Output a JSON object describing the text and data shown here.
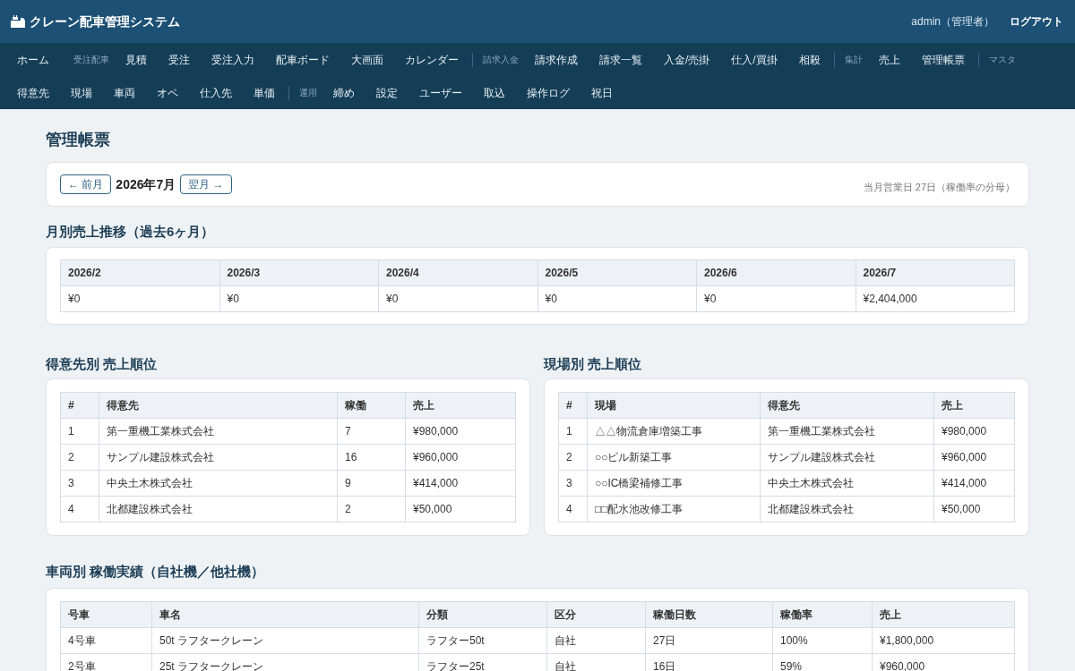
{
  "header": {
    "title": "クレーン配車管理システム",
    "user": "admin（管理者）",
    "logout": "ログアウト"
  },
  "nav": {
    "items": [
      {
        "kind": "link",
        "label": "ホーム"
      },
      {
        "kind": "group",
        "label": "受注配車",
        "divider": false
      },
      {
        "kind": "link",
        "label": "見積"
      },
      {
        "kind": "link",
        "label": "受注"
      },
      {
        "kind": "link",
        "label": "受注入力"
      },
      {
        "kind": "link",
        "label": "配車ボード"
      },
      {
        "kind": "link",
        "label": "大画面"
      },
      {
        "kind": "link",
        "label": "カレンダー"
      },
      {
        "kind": "group",
        "label": "請求入金",
        "divider": true
      },
      {
        "kind": "link",
        "label": "請求作成"
      },
      {
        "kind": "link",
        "label": "請求一覧"
      },
      {
        "kind": "link",
        "label": "入金/売掛"
      },
      {
        "kind": "link",
        "label": "仕入/買掛"
      },
      {
        "kind": "link",
        "label": "相殺"
      },
      {
        "kind": "group",
        "label": "集計",
        "divider": true
      },
      {
        "kind": "link",
        "label": "売上"
      },
      {
        "kind": "link",
        "label": "管理帳票"
      },
      {
        "kind": "group",
        "label": "マスタ",
        "divider": true
      },
      {
        "kind": "link",
        "label": "得意先"
      },
      {
        "kind": "link",
        "label": "現場"
      },
      {
        "kind": "link",
        "label": "車両"
      },
      {
        "kind": "link",
        "label": "オペ"
      },
      {
        "kind": "link",
        "label": "仕入先"
      },
      {
        "kind": "link",
        "label": "単価"
      },
      {
        "kind": "group",
        "label": "運用",
        "divider": true
      },
      {
        "kind": "link",
        "label": "締め"
      },
      {
        "kind": "link",
        "label": "設定"
      },
      {
        "kind": "link",
        "label": "ユーザー"
      },
      {
        "kind": "link",
        "label": "取込"
      },
      {
        "kind": "link",
        "label": "操作ログ"
      },
      {
        "kind": "link",
        "label": "祝日"
      }
    ]
  },
  "page_title": "管理帳票",
  "month_bar": {
    "prev": "← 前月",
    "month": "2026年7月",
    "next": "翌月 →",
    "note": "当月営業日 27日（稼働率の分母）"
  },
  "monthly_sales": {
    "heading": "月別売上推移（過去6ヶ月）",
    "columns": [
      "2026/2",
      "2026/3",
      "2026/4",
      "2026/5",
      "2026/6",
      "2026/7"
    ],
    "rows": [
      [
        "¥0",
        "¥0",
        "¥0",
        "¥0",
        "¥0",
        "¥2,404,000"
      ]
    ]
  },
  "customer_ranking": {
    "heading": "得意先別 売上順位",
    "columns": [
      "#",
      "得意先",
      "稼働",
      "売上"
    ],
    "rows": [
      [
        "1",
        "第一重機工業株式会社",
        "7",
        "¥980,000"
      ],
      [
        "2",
        "サンプル建設株式会社",
        "16",
        "¥960,000"
      ],
      [
        "3",
        "中央土木株式会社",
        "9",
        "¥414,000"
      ],
      [
        "4",
        "北都建設株式会社",
        "2",
        "¥50,000"
      ]
    ]
  },
  "site_ranking": {
    "heading": "現場別 売上順位",
    "columns": [
      "#",
      "現場",
      "得意先",
      "売上"
    ],
    "rows": [
      [
        "1",
        "△△物流倉庫増築工事",
        "第一重機工業株式会社",
        "¥980,000"
      ],
      [
        "2",
        "○○ビル新築工事",
        "サンプル建設株式会社",
        "¥960,000"
      ],
      [
        "3",
        "○○IC橋梁補修工事",
        "中央土木株式会社",
        "¥414,000"
      ],
      [
        "4",
        "□□配水池改修工事",
        "北都建設株式会社",
        "¥50,000"
      ]
    ]
  },
  "vehicle_performance": {
    "heading": "車両別 稼働実績（自社機／他社機）",
    "columns": [
      "号車",
      "車名",
      "分類",
      "区分",
      "稼働日数",
      "稼働率",
      "売上"
    ],
    "rows": [
      [
        "4号車",
        "50t ラフタークレーン",
        "ラフター50t",
        "自社",
        "27日",
        "100%",
        "¥1,800,000"
      ],
      [
        "2号車",
        "25t ラフタークレーン",
        "ラフター25t",
        "自社",
        "16日",
        "59%",
        "¥960,000"
      ]
    ]
  }
}
